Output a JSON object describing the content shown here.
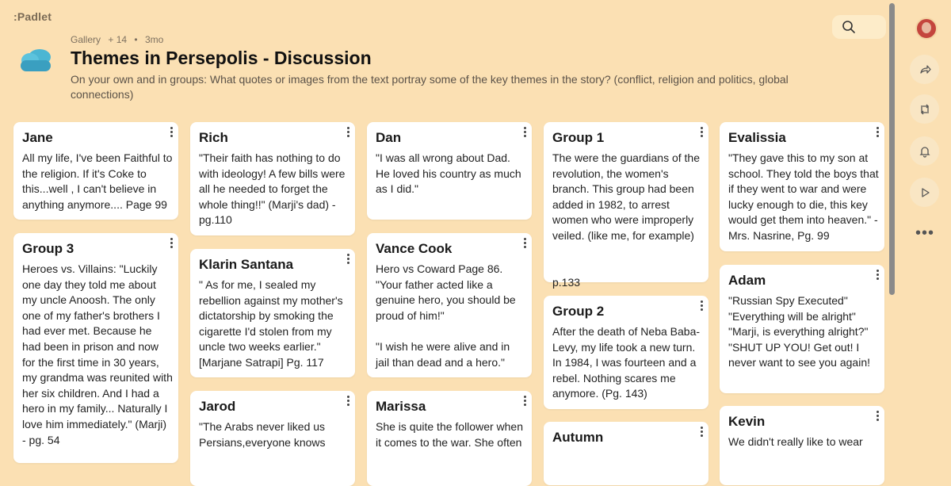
{
  "app": {
    "logo": ":Padlet"
  },
  "header": {
    "meta": {
      "section": "Gallery",
      "contributors": "+ 14",
      "age": "3mo"
    },
    "title": "Themes in Persepolis - Discussion",
    "description": "On your own and in groups: What quotes or images from the text portray some of the key themes in the story? (conflict, religion and politics, global connections)"
  },
  "sidebar": {
    "icons": [
      "share-icon",
      "remake-icon",
      "bell-icon",
      "play-icon",
      "more-icon"
    ],
    "more_label": "•••"
  },
  "columns": [
    [
      {
        "author": "Jane",
        "body": "All my life, I've been Faithful to the religion. If it's Coke to this...well , I can't believe in anything anymore.... Page 99"
      },
      {
        "author": "Group 3",
        "body": "Heroes vs. Villains: \"Luckily one day they told me about my uncle Anoosh. The only one of my father's brothers I had ever met. Because he had been in prison and now for the first time in 30 years, my grandma was reunited with her six children. And I had a hero in my family... Naturally I love him immediately.\" (Marji) - pg. 54"
      }
    ],
    [
      {
        "author": "Rich",
        "body": "\"Their faith has nothing to do with ideology! A few bills were all he needed to forget the whole thing!!\" (Marji's dad) - pg.110"
      },
      {
        "author": "Klarin Santana",
        "body": "\" As for me, I sealed my rebellion against my mother's dictatorship by smoking the cigarette I'd stolen from my uncle two weeks earlier.\" [Marjane Satrapi] Pg. 117"
      },
      {
        "author": "Jarod",
        "body": "\"The Arabs never liked us Persians,everyone knows"
      }
    ],
    [
      {
        "author": "Dan",
        "body": "\"I was all wrong about Dad. He loved his country as much as I did.\""
      },
      {
        "author": "Vance Cook",
        "body": "Hero vs Coward Page 86.\n \"Your father acted like a genuine hero, you should be proud of him!\"\n\n\"I wish he were alive and in jail than dead and a hero.\""
      },
      {
        "author": "Marissa",
        "body": "She is quite the follower when it comes to the war. She often"
      }
    ],
    [
      {
        "author": "Group  1",
        "body": "The were the guardians of the revolution, the women's branch. This group had been added in 1982, to arrest women who were improperly veiled. (like me, for example)\n\n\np.133"
      },
      {
        "author": "Group 2",
        "body": "After the death of Neba Baba-Levy, my life took a new turn. In 1984, I was fourteen and a rebel. Nothing scares me anymore. (Pg. 143)"
      },
      {
        "author": "Autumn",
        "body": ""
      }
    ],
    [
      {
        "author": "Evalissia",
        "body": "\"They gave this to my son at school. They told the boys that if they went to war and were lucky enough to die, this key would get them into heaven.\" -Mrs. Nasrine, Pg. 99"
      },
      {
        "author": "Adam",
        "body": "\"Russian Spy Executed\"\n\"Everything will be alright\"\n\"Marji, is everything alright?\"\n\"SHUT UP YOU! Get out! I never want to see you again!"
      },
      {
        "author": "Kevin",
        "body": "We didn't really like to wear"
      }
    ]
  ]
}
